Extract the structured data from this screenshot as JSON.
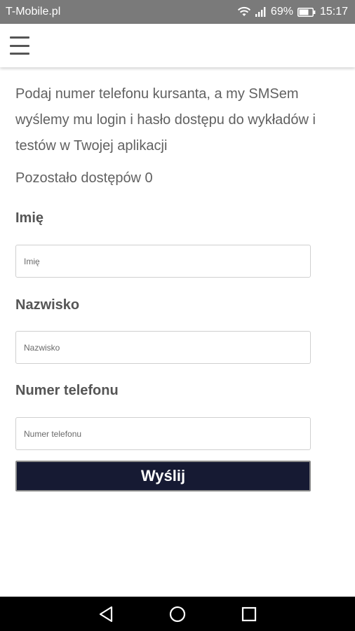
{
  "status_bar": {
    "carrier": "T-Mobile.pl",
    "battery": "69%",
    "time": "15:17"
  },
  "page": {
    "intro_text": "Podaj numer telefonu kursanta, a my SMSem wyślemy mu login i hasło dostępu do wykładów i testów w Twojej aplikacji",
    "remaining_text": "Pozostało dostępów 0"
  },
  "form": {
    "first_name": {
      "label": "Imię",
      "placeholder": "Imię",
      "value": ""
    },
    "last_name": {
      "label": "Nazwisko",
      "placeholder": "Nazwisko",
      "value": ""
    },
    "phone": {
      "label": "Numer telefonu",
      "placeholder": "Numer telefonu",
      "value": ""
    },
    "submit_label": "Wyślij"
  },
  "icons": {
    "menu": "hamburger-menu-icon",
    "wifi": "wifi-icon",
    "signal": "signal-icon",
    "battery": "battery-icon",
    "back": "back-icon",
    "home": "home-icon",
    "recents": "recents-icon"
  },
  "colors": {
    "status_bar": "#7a7a7a",
    "submit_button": "#161a33",
    "nav_bar": "#000000"
  }
}
